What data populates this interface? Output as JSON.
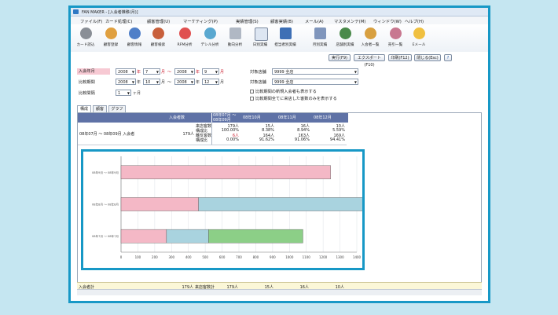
{
  "window": {
    "title": "FAN MAKER - [入会者推移(月)]"
  },
  "menu": [
    "ファイル(F)",
    "カード処理(C)",
    "顧客管理(U)",
    "マーケティング(P)",
    "実績管理(S)",
    "顧客実績(B)",
    "メール(A)",
    "マスタメンテ(M)",
    "ウィンドウ(W)",
    "ヘルプ(H)"
  ],
  "toolbar": [
    {
      "label": "カード読込",
      "icon": "card-reader-icon"
    },
    {
      "label": "顧客登録",
      "icon": "add-customer-icon"
    },
    {
      "label": "顧客情報",
      "icon": "customer-info-icon"
    },
    {
      "label": "顧客検索",
      "icon": "customer-search-icon"
    },
    {
      "label": "RFM分析",
      "icon": "rfm-icon"
    },
    {
      "label": "デシル分析",
      "icon": "decile-icon"
    },
    {
      "label": "動向分析",
      "icon": "trend-icon"
    },
    {
      "label": "日別実績",
      "icon": "calendar-icon"
    },
    {
      "label": "担当者別実績",
      "icon": "staff-icon"
    },
    {
      "label": "月別実績",
      "icon": "monthly-icon"
    },
    {
      "label": "店舗別実績",
      "icon": "store-icon"
    },
    {
      "label": "入会者一覧",
      "icon": "member-list-icon"
    },
    {
      "label": "売引一覧",
      "icon": "discount-list-icon"
    },
    {
      "label": "Eメール",
      "icon": "email-icon"
    }
  ],
  "buttons": {
    "run": "実行(F9)",
    "export": "エクスポート(F10)",
    "print": "印刷(F12)",
    "close": "閉じる(Esc)"
  },
  "filters": {
    "join_label": "入会年月",
    "compare_label": "比較期間",
    "interval_label": "比較間隔",
    "year_unit": "年",
    "month_unit": "月",
    "tilde": "〜",
    "join_from_year": "2008",
    "join_from_month": "7",
    "join_to_year": "2008",
    "join_to_month": "9",
    "cmp_from_year": "2008",
    "cmp_from_month": "10",
    "cmp_to_year": "2008",
    "cmp_to_month": "12",
    "interval_value": "1",
    "interval_unit": "ヶ月",
    "store_label": "対象店舗",
    "store_value": "9999 全店",
    "store2_label": "対象店舗",
    "store2_value": "9999 全店",
    "check1": "比較期間の新規入会者も表示する",
    "check2": "比較期間全てに来店した客数のみを表示する"
  },
  "tabs": [
    "構成",
    "顧客",
    "グラフ"
  ],
  "grid": {
    "head_members": "入会者数",
    "period_head": "08年07月 〜 08年09月",
    "month_heads": [
      "08年10月",
      "08年11月",
      "08年12月"
    ],
    "row_label": "08年07月 〜 08年09月 入会者",
    "row_members": "179人",
    "metric_labels": [
      "来店客数",
      "構成比",
      "離反客数",
      "構成比"
    ],
    "period_values": [
      "179人",
      "100.00%",
      "6人",
      "0.00%"
    ],
    "col1": [
      "15人",
      "8.38%",
      "164人",
      "91.62%"
    ],
    "col2": [
      "16人",
      "8.94%",
      "163人",
      "91.06%"
    ],
    "col3": [
      "10人",
      "5.59%",
      "169人",
      "94.41%"
    ],
    "footer_label": "入会者計",
    "footer_members": "179人",
    "footer_metric": "来店客数計",
    "footer_values": [
      "179人",
      "15人",
      "16人",
      "10人"
    ]
  },
  "chart_data": {
    "type": "bar",
    "orientation": "horizontal",
    "stacked": true,
    "categories": [
      "08年9月 〜 08年9月",
      "08年8月 〜 08年8月",
      "08年7月 〜 08年7月"
    ],
    "series": [
      {
        "values": [
          1245,
          460,
          270
        ],
        "color": "#f4b8c6"
      },
      {
        "values": [
          0,
          1020,
          250
        ],
        "color": "#a9d3df"
      },
      {
        "values": [
          0,
          0,
          560
        ],
        "color": "#8ccf87"
      }
    ],
    "xlim": [
      0,
      1400
    ],
    "ticks": [
      0,
      100,
      200,
      300,
      400,
      500,
      600,
      700,
      800,
      900,
      1000,
      1100,
      1200,
      1300,
      1400
    ],
    "grid": true
  }
}
